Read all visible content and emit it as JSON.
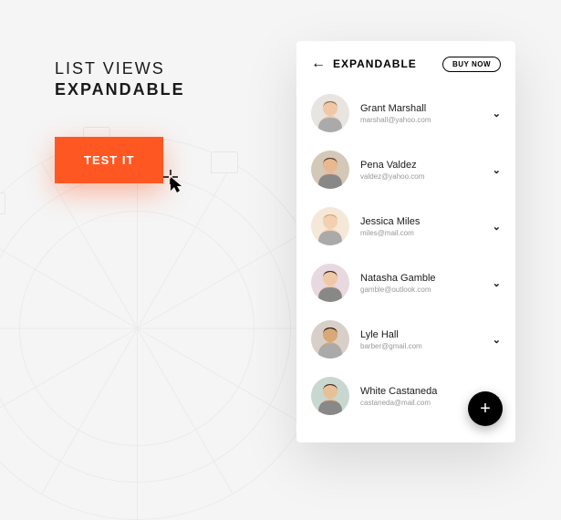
{
  "heading": {
    "line1": "LIST VIEWS",
    "line2": "EXPANDABLE"
  },
  "cta": {
    "label": "TEST IT"
  },
  "phone": {
    "title": "EXPANDABLE",
    "buy_label": "BUY NOW",
    "fab_label": "+",
    "contacts": [
      {
        "name": "Grant Marshall",
        "email": "marshall@yahoo.com",
        "bg": "#e8e4e0",
        "skin": "#f0c8a8",
        "hair": "#8b6f47"
      },
      {
        "name": "Pena Valdez",
        "email": "valdez@yahoo.com",
        "bg": "#d4c8b8",
        "skin": "#e8b890",
        "hair": "#5a3820"
      },
      {
        "name": "Jessica Miles",
        "email": "miles@mail.com",
        "bg": "#f5e8d8",
        "skin": "#f5d0b0",
        "hair": "#d4a870"
      },
      {
        "name": "Natasha Gamble",
        "email": "gamble@outlook.com",
        "bg": "#e8d8e0",
        "skin": "#f0c8a8",
        "hair": "#3a2818"
      },
      {
        "name": "Lyle Hall",
        "email": "barber@gmail.com",
        "bg": "#d8d0c8",
        "skin": "#d8a878",
        "hair": "#2a1810"
      },
      {
        "name": "White Castaneda",
        "email": "castaneda@mail.com",
        "bg": "#c8d8d0",
        "skin": "#e8c098",
        "hair": "#4a3020"
      }
    ]
  }
}
